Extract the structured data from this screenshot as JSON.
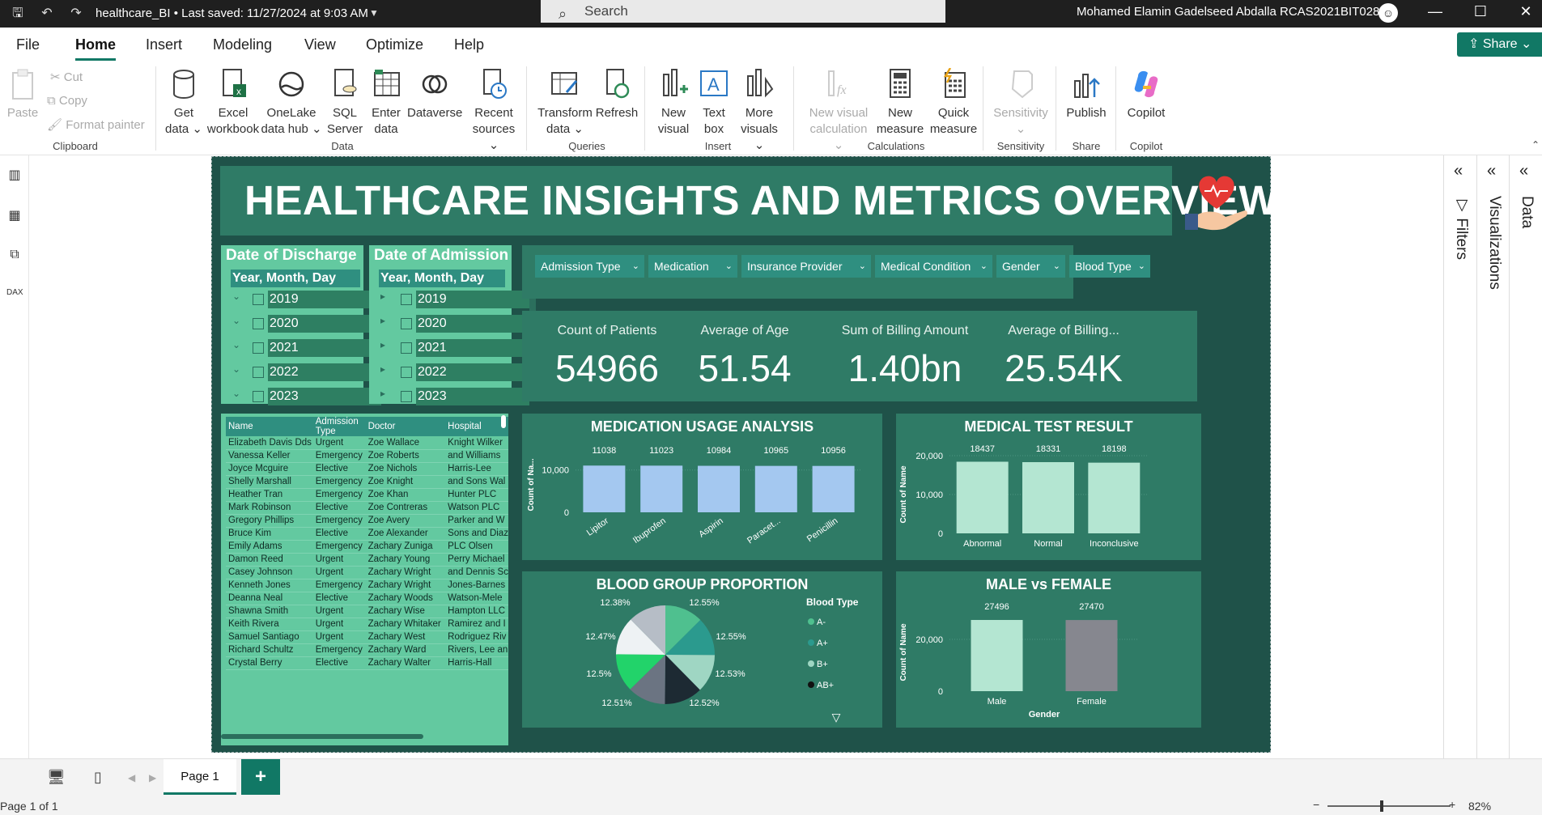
{
  "titlebar": {
    "doc_title": "healthcare_BI  •  Last saved: 11/27/2024 at 9:03 AM",
    "search_placeholder": "Search",
    "user": "Mohamed Elamin Gadelseed Abdalla RCAS2021BIT028"
  },
  "menu": {
    "tabs": [
      "File",
      "Home",
      "Insert",
      "Modeling",
      "View",
      "Optimize",
      "Help"
    ],
    "share": "Share"
  },
  "ribbon": {
    "clipboard": {
      "paste": "Paste",
      "cut": "Cut",
      "copy": "Copy",
      "format_painter": "Format painter",
      "label": "Clipboard"
    },
    "data": {
      "items": [
        {
          "l1": "Get",
          "l2": "data ⌄"
        },
        {
          "l1": "Excel",
          "l2": "workbook"
        },
        {
          "l1": "OneLake",
          "l2": "data hub ⌄"
        },
        {
          "l1": "SQL",
          "l2": "Server"
        },
        {
          "l1": "Enter",
          "l2": "data"
        },
        {
          "l1": "Dataverse",
          "l2": ""
        },
        {
          "l1": "Recent",
          "l2": "sources ⌄"
        }
      ],
      "label": "Data"
    },
    "queries": {
      "items": [
        {
          "l1": "Transform",
          "l2": "data ⌄"
        },
        {
          "l1": "Refresh",
          "l2": ""
        }
      ],
      "label": "Queries"
    },
    "insert": {
      "items": [
        {
          "l1": "New",
          "l2": "visual"
        },
        {
          "l1": "Text",
          "l2": "box"
        },
        {
          "l1": "More",
          "l2": "visuals ⌄"
        }
      ],
      "label": "Insert"
    },
    "calculations": {
      "items": [
        {
          "l1": "New visual",
          "l2": "calculation ⌄"
        },
        {
          "l1": "New",
          "l2": "measure"
        },
        {
          "l1": "Quick",
          "l2": "measure"
        }
      ],
      "label": "Calculations"
    },
    "sensitivity": {
      "item": "Sensitivity",
      "label": "Sensitivity"
    },
    "share": {
      "item": "Publish",
      "label": "Share"
    },
    "copilot": {
      "item": "Copilot",
      "label": "Copilot"
    }
  },
  "panes": {
    "filters": "Filters",
    "visualizations": "Visualizations",
    "data": "Data"
  },
  "report": {
    "title": "HEALTHCARE INSIGHTS AND METRICS OVERVIEW",
    "discharge": {
      "title": "Date of Discharge",
      "header": "Year, Month, Day",
      "years": [
        "2019",
        "2020",
        "2021",
        "2022",
        "2023"
      ]
    },
    "admission": {
      "title": "Date of Admission",
      "header": "Year, Month, Day",
      "years": [
        "2019",
        "2020",
        "2021",
        "2022",
        "2023"
      ]
    },
    "filters": [
      "Admission Type",
      "Medication",
      "Insurance Provider",
      "Medical Condition",
      "Gender",
      "Blood Type"
    ],
    "kpis": [
      {
        "label": "Count of Patients",
        "value": "54966"
      },
      {
        "label": "Average of Age",
        "value": "51.54"
      },
      {
        "label": "Sum of Billing Amount",
        "value": "1.40bn"
      },
      {
        "label": "Average of Billing...",
        "value": "25.54K"
      }
    ],
    "table": {
      "headers": [
        "Name",
        "Admission Type",
        "Doctor",
        "Hospital"
      ],
      "rows": [
        [
          "Elizabeth Davis Dds",
          "Urgent",
          "Zoe Wallace",
          "Knight Wilker"
        ],
        [
          "Vanessa Keller",
          "Emergency",
          "Zoe Roberts",
          "and Williams"
        ],
        [
          "Joyce Mcguire",
          "Elective",
          "Zoe Nichols",
          "Harris-Lee"
        ],
        [
          "Shelly Marshall",
          "Emergency",
          "Zoe Knight",
          "and Sons Wal"
        ],
        [
          "Heather Tran",
          "Emergency",
          "Zoe Khan",
          "Hunter PLC"
        ],
        [
          "Mark Robinson",
          "Elective",
          "Zoe Contreras",
          "Watson PLC"
        ],
        [
          "Gregory Phillips",
          "Emergency",
          "Zoe Avery",
          "Parker and W"
        ],
        [
          "Bruce Kim",
          "Elective",
          "Zoe Alexander",
          "Sons and Diaz"
        ],
        [
          "Emily Adams",
          "Emergency",
          "Zachary Zuniga",
          "PLC Olsen"
        ],
        [
          "Damon Reed",
          "Urgent",
          "Zachary Young",
          "Perry Michael"
        ],
        [
          "Casey Johnson",
          "Urgent",
          "Zachary Wright",
          "and Dennis Sc"
        ],
        [
          "Kenneth Jones",
          "Emergency",
          "Zachary Wright",
          "Jones-Barnes"
        ],
        [
          "Deanna Neal",
          "Elective",
          "Zachary Woods",
          "Watson-Mele"
        ],
        [
          "Shawna Smith",
          "Urgent",
          "Zachary Wise",
          "Hampton LLC"
        ],
        [
          "Keith Rivera",
          "Urgent",
          "Zachary Whitaker",
          "Ramirez and I"
        ],
        [
          "Samuel Santiago",
          "Urgent",
          "Zachary West",
          "Rodriguez Riv"
        ],
        [
          "Richard Schultz",
          "Emergency",
          "Zachary Ward",
          "Rivers, Lee an"
        ],
        [
          "Crystal Berry",
          "Elective",
          "Zachary Walter",
          "Harris-Hall"
        ]
      ]
    }
  },
  "chart_data": [
    {
      "type": "bar",
      "title": "MEDICATION USAGE ANALYSIS",
      "categories": [
        "Lipitor",
        "Ibuprofen",
        "Aspirin",
        "Paracet...",
        "Penicillin"
      ],
      "values": [
        11038,
        11023,
        10984,
        10965,
        10956
      ],
      "ylabel": "Count of Na...",
      "yticks": [
        "10,000",
        "0"
      ],
      "ylim": [
        0,
        13000
      ],
      "color": "#a4c8f0"
    },
    {
      "type": "bar",
      "title": "MEDICAL TEST RESULT",
      "categories": [
        "Abnormal",
        "Normal",
        "Inconclusive"
      ],
      "values": [
        18437,
        18331,
        18198
      ],
      "ylabel": "Count of Name",
      "yticks": [
        "20,000",
        "10,000",
        "0"
      ],
      "ylim": [
        0,
        20000
      ],
      "color": "#b4e6d2"
    },
    {
      "type": "pie",
      "title": "BLOOD GROUP PROPORTION",
      "legend_title": "Blood Type",
      "legend": [
        "A-",
        "A+",
        "B+",
        "AB+"
      ],
      "slice_labels": [
        "12.55%",
        "12.55%",
        "12.53%",
        "12.52%",
        "12.51%",
        "12.5%",
        "12.47%",
        "12.38%"
      ],
      "values": [
        12.55,
        12.55,
        12.53,
        12.52,
        12.51,
        12.5,
        12.47,
        12.38
      ],
      "colors": [
        "#4fc08f",
        "#2b9a8e",
        "#9fd6c3",
        "#1d2a33",
        "#6b7482",
        "#22d36a",
        "#eef2f4",
        "#b6bdc6"
      ]
    },
    {
      "type": "bar",
      "title": "MALE vs FEMALE",
      "categories": [
        "Male",
        "Female"
      ],
      "values": [
        27496,
        27470
      ],
      "ylabel": "Count of Name",
      "xlabel": "Gender",
      "yticks": [
        "20,000",
        "0"
      ],
      "ylim": [
        0,
        30000
      ],
      "colors": [
        "#b4e6d2",
        "#86878f"
      ]
    }
  ],
  "footer": {
    "page_tab": "Page 1",
    "add": "+",
    "status": "Page 1 of 1",
    "zoom": "82%"
  }
}
